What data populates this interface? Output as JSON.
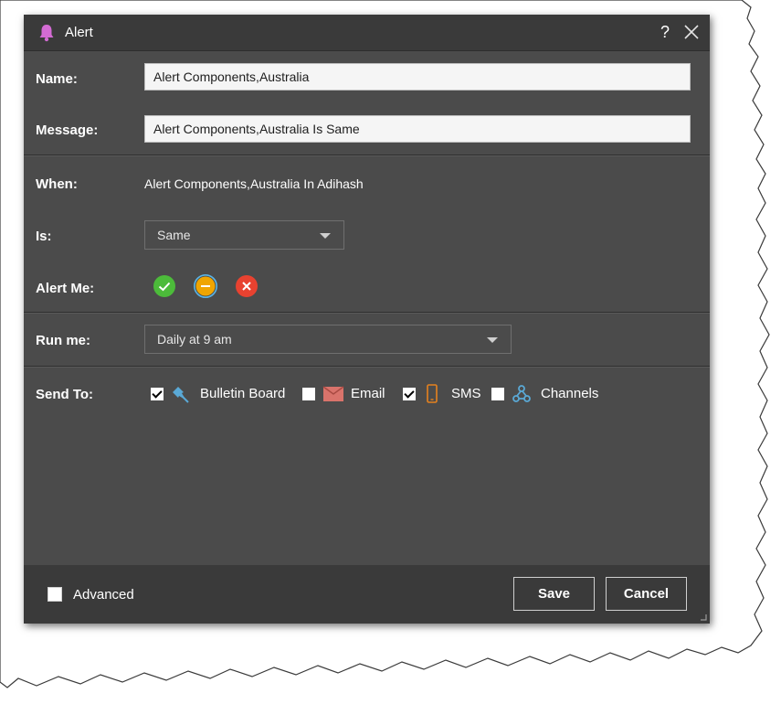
{
  "dialog": {
    "title": "Alert",
    "help_label": "?",
    "title_icon": "bell-icon",
    "title_icon_color": "#d36bd3"
  },
  "form": {
    "name_label": "Name:",
    "name_value": "Alert Components,Australia",
    "message_label": "Message:",
    "message_value": "Alert Components,Australia Is Same",
    "when_label": "When:",
    "when_value": "Alert Components,Australia In Adihash",
    "is_label": "Is:",
    "is_selected": "Same",
    "alert_me_label": "Alert Me:",
    "alert_me_options": [
      {
        "icon": "check-circle-icon",
        "color": "#4cbb3a",
        "selected": false
      },
      {
        "icon": "minus-circle-icon",
        "color": "#f0a500",
        "selected": true
      },
      {
        "icon": "x-circle-icon",
        "color": "#e84230",
        "selected": false
      }
    ],
    "run_me_label": "Run me:",
    "run_me_selected": "Daily at 9 am",
    "send_to_label": "Send To:",
    "send_to": [
      {
        "label": "Bulletin Board",
        "checked": true,
        "icon": "pushpin-icon",
        "color": "#5aa9d6"
      },
      {
        "label": "Email",
        "checked": false,
        "icon": "envelope-icon",
        "color": "#d9736b"
      },
      {
        "label": "SMS",
        "checked": true,
        "icon": "mobile-phone-icon",
        "color": "#e6821e"
      },
      {
        "label": "Channels",
        "checked": false,
        "icon": "webhook-icon",
        "color": "#5aa9d6"
      }
    ]
  },
  "footer": {
    "advanced_label": "Advanced",
    "advanced_checked": false,
    "save_label": "Save",
    "cancel_label": "Cancel"
  },
  "colors": {
    "dialog_bg": "#4b4b4b",
    "titlebar_bg": "#3a3a3a",
    "footer_bg": "#3a3a3a",
    "input_bg": "#f5f5f5"
  }
}
